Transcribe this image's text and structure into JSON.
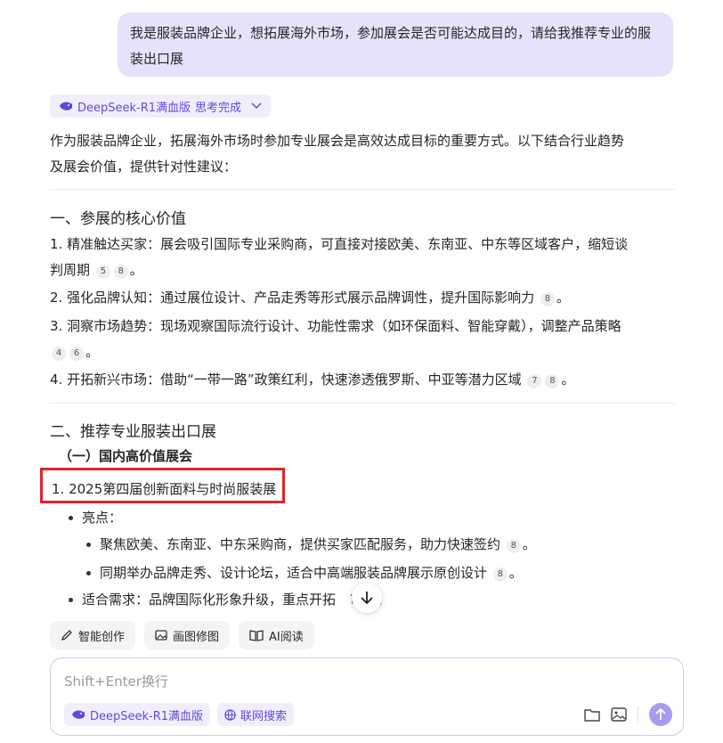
{
  "user_message": "我是服装品牌企业，想拓展海外市场，参加展会是否可能达成目的，请给我推荐专业的服装出口展",
  "model_chip": {
    "label": "DeepSeek-R1满血版",
    "status": "思考完成"
  },
  "intro_line1": "作为服装品牌企业，拓展海外市场时参加专业展会是高效达成目标的重要方式。以下结合行业趋势",
  "intro_line2": "及展会价值，提供针对性建议：",
  "section1": {
    "title": "一、参展的核心价值",
    "items": [
      {
        "line1": "1. 精准触达买家：展会吸引国际专业采购商，可直接对接欧美、东南亚、中东等区域客户，缩短谈",
        "line2": "判周期",
        "cites": [
          "5",
          "8"
        ]
      },
      {
        "line1": "2. 强化品牌认知：通过展位设计、产品走秀等形式展示品牌调性，提升国际影响力",
        "cites": [
          "8"
        ]
      },
      {
        "line1": "3. 洞察市场趋势：现场观察国际流行设计、功能性需求（如环保面料、智能穿戴），调整产品策略",
        "cites": [
          "4",
          "6"
        ]
      },
      {
        "line1": "4. 开拓新兴市场：借助“一带一路”政策红利，快速渗透俄罗斯、中亚等潜力区域",
        "cites": [
          "7",
          "8"
        ]
      }
    ]
  },
  "section2": {
    "title": "二、推荐专业服装出口展",
    "subtitle": "（一）国内高价值展会",
    "item1": "1. 2025第四届创新面料与时尚服装展",
    "bullet_highlights": "亮点：",
    "sub1": {
      "text": "聚焦欧美、东南亚、中东采购商，提供买家匹配服务，助力快速签约",
      "cite": "8"
    },
    "sub2": {
      "text": "同期举办品牌走秀、设计论坛，适合中高端服装品牌展示原创设计",
      "cite": "8"
    },
    "bullet_fit": {
      "before": "适合需求：品牌国际化形象升级，重点开拓",
      "after": "市场。"
    }
  },
  "tools": [
    {
      "label": "智能创作",
      "icon": "pen-icon"
    },
    {
      "label": "画图修图",
      "icon": "image-icon"
    },
    {
      "label": "AI阅读",
      "icon": "book-icon"
    }
  ],
  "composer": {
    "placeholder": "Shift+Enter换行",
    "model_label": "DeepSeek-R1满血版",
    "search_label": "联网搜索"
  },
  "colors": {
    "accent": "#5e4bd6",
    "bubble": "#e6e2fb",
    "highlight_box": "#e0232a"
  }
}
